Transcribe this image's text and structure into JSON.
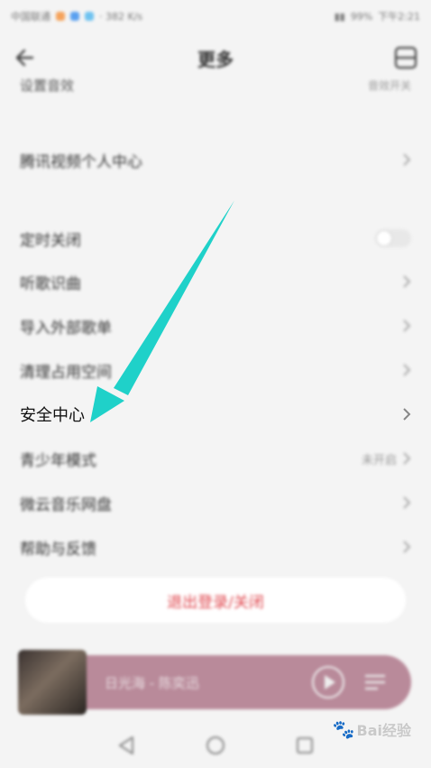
{
  "status_bar": {
    "carrier": "中国联通",
    "speed": "· 382 K/s",
    "battery": "99%",
    "time": "下午2:21"
  },
  "header": {
    "title": "更多",
    "back_icon": "back-arrow-icon",
    "right_icon": "scan-icon"
  },
  "top_partial": {
    "label": "设置音效",
    "value": "音效开关"
  },
  "rows": [
    {
      "label": "腾讯视频个人中心",
      "value": ""
    },
    {
      "label": "定时关闭",
      "value": ""
    },
    {
      "label": "听歌识曲",
      "value": ""
    },
    {
      "label": "导入外部歌单",
      "value": ""
    },
    {
      "label": "清理占用空间",
      "value": ""
    },
    {
      "label": "安全中心",
      "value": ""
    },
    {
      "label": "青少年模式",
      "value": "未开启"
    },
    {
      "label": "微云音乐网盘",
      "value": ""
    },
    {
      "label": "帮助与反馈",
      "value": ""
    }
  ],
  "logout_label": "退出登录/关闭",
  "player": {
    "song": "日光海 - 陈奕迅"
  },
  "watermark": "Bai经验",
  "colors": {
    "accent_arrow": "#1fd1c9",
    "logout_text": "#e0484f",
    "player_bg": "#b98a9a"
  }
}
